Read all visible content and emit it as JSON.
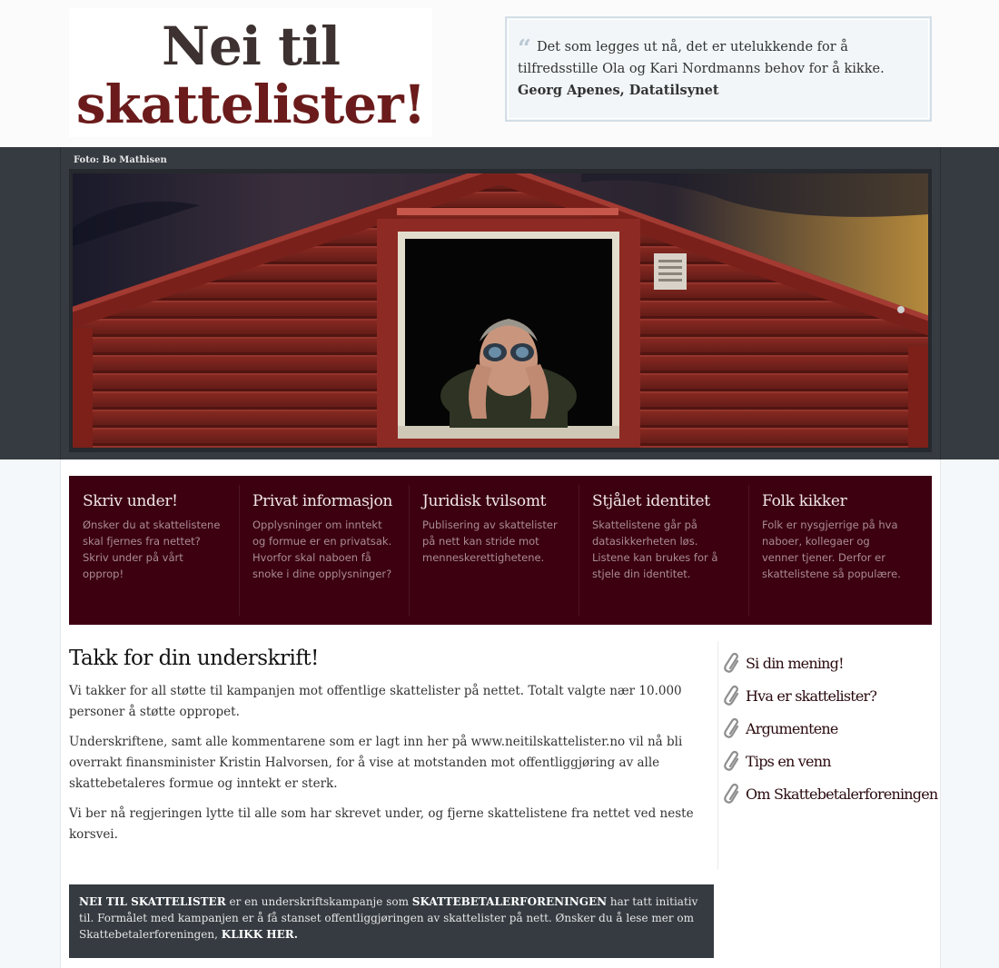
{
  "header": {
    "logo_line1": "Nei til",
    "logo_line2": "skattelister!",
    "quote": {
      "text": "Det som legges ut nå, det er utelukkende for å tilfredsstille Ola og Kari Nordmanns behov for å kikke.",
      "author": "Georg Apenes, Datatilsynet"
    }
  },
  "photo": {
    "credit": "Foto: Bo Mathisen"
  },
  "features": [
    {
      "title": "Skriv under!",
      "text": "Ønsker du at skattelistene skal fjernes fra nettet? Skriv under på vårt opprop!"
    },
    {
      "title": "Privat informasjon",
      "text": "Opplysninger om inntekt og formue er en privatsak. Hvorfor skal naboen få snoke i dine opplysninger?"
    },
    {
      "title": "Juridisk tvilsomt",
      "text": "Publisering av skattelister på nett kan stride mot menneskerettighetene."
    },
    {
      "title": "Stjålet identitet",
      "text": "Skattelistene går på datasikkerheten løs. Listene kan brukes for å stjele din identitet."
    },
    {
      "title": "Folk kikker",
      "text": "Folk er nysgjerrige på hva naboer, kollegaer og venner tjener. Derfor er skattelistene så populære."
    }
  ],
  "article": {
    "title": "Takk for din underskrift!",
    "paragraphs": [
      "Vi takker for all støtte til kampanjen mot offentlige skattelister på nettet. Totalt valgte nær 10.000 personer å støtte oppropet.",
      "Underskriftene, samt alle kommentarene som er lagt inn her på www.neitilskattelister.no vil nå bli overrakt finansminister Kristin Halvorsen, for å vise at motstanden mot offentliggjøring av alle skattebetaleres formue og inntekt er sterk.",
      "Vi ber nå regjeringen lytte til alle som har skrevet under, og fjerne skattelistene fra nettet ved neste korsvei."
    ]
  },
  "sidebar": {
    "links": [
      "Si din mening!",
      "Hva er skattelister?",
      "Argumentene",
      "Tips en venn",
      "Om Skattebetalerforeningen"
    ],
    "icon": "paperclip-icon"
  },
  "footer": {
    "campaign_name": "NEI TIL SKATTELISTER",
    "text1": " er en underskriftskampanje som ",
    "org_name": "SKATTEBETALERFORENINGEN",
    "text2": " har tatt initiativ til. Formålet med kampanjen er å få stanset offentliggjøringen av skattelister på nett. Ønsker du å lese mer om Skattebetalerforeningen, ",
    "link_label": "KLIKK HER."
  },
  "colors": {
    "feature_bg": "#3c0011",
    "band_bg": "#353b41",
    "logo_dark": "#3d3231",
    "logo_red": "#6b1b1b"
  }
}
